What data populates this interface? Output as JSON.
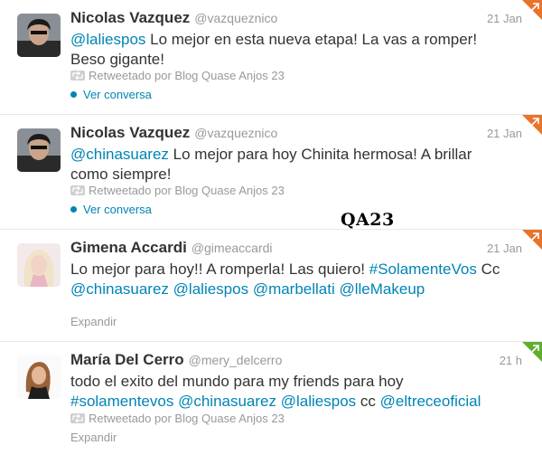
{
  "tweets": [
    {
      "name": "Nicolas Vazquez",
      "handle": "@vazqueznico",
      "time": "21 Jan",
      "text_parts": [
        {
          "t": "@laliespos",
          "link": true
        },
        {
          "t": " Lo mejor en esta nueva etapa! La vas a romper! Beso gigante!",
          "link": false
        }
      ],
      "retweeted_by": "Retweetado por Blog Quase Anjos 23",
      "action": "Ver conversa",
      "corner_color": "#e8732a"
    },
    {
      "name": "Nicolas Vazquez",
      "handle": "@vazqueznico",
      "time": "21 Jan",
      "text_parts": [
        {
          "t": "@chinasuarez",
          "link": true
        },
        {
          "t": " Lo mejor para hoy Chinita hermosa! A brillar como siempre!",
          "link": false
        }
      ],
      "retweeted_by": "Retweetado por Blog Quase Anjos 23",
      "action": "Ver conversa",
      "corner_color": "#e8732a"
    },
    {
      "name": "Gimena Accardi",
      "handle": "@gimeaccardi",
      "time": "21 Jan",
      "text_parts": [
        {
          "t": "Lo mejor para hoy!! A romperla! Las quiero! ",
          "link": false
        },
        {
          "t": "#SolamenteVos",
          "link": true
        },
        {
          "t": " Cc ",
          "link": false
        },
        {
          "t": "@chinasuarez",
          "link": true
        },
        {
          "t": " ",
          "link": false
        },
        {
          "t": "@laliespos",
          "link": true
        },
        {
          "t": " ",
          "link": false
        },
        {
          "t": "@marbellati",
          "link": true
        },
        {
          "t": " ",
          "link": false
        },
        {
          "t": "@lleMakeup",
          "link": true
        }
      ],
      "retweeted_by": "",
      "action": "Expandir",
      "corner_color": "#e8732a"
    },
    {
      "name": "María Del Cerro",
      "handle": "@mery_delcerro",
      "time": "21 h",
      "text_parts": [
        {
          "t": "todo el exito del mundo para my friends para hoy ",
          "link": false
        },
        {
          "t": "#solamentevos",
          "link": true
        },
        {
          "t": " ",
          "link": false
        },
        {
          "t": "@chinasuarez",
          "link": true
        },
        {
          "t": " ",
          "link": false
        },
        {
          "t": "@laliespos",
          "link": true
        },
        {
          "t": " cc ",
          "link": false
        },
        {
          "t": "@eltreceoficial",
          "link": true
        }
      ],
      "retweeted_by": "Retweetado por Blog Quase Anjos 23",
      "action": "Expandir",
      "corner_color": "#5fae2e"
    }
  ],
  "watermark": "QA23",
  "icons": {
    "retweet": "retweet-icon",
    "conversation": "conversation-dot-icon",
    "corner": "retweeted-corner-icon"
  },
  "colors": {
    "link": "#0084b4",
    "muted": "#999999",
    "retweet_corner_orange": "#e8732a",
    "retweet_corner_green": "#5fae2e"
  }
}
